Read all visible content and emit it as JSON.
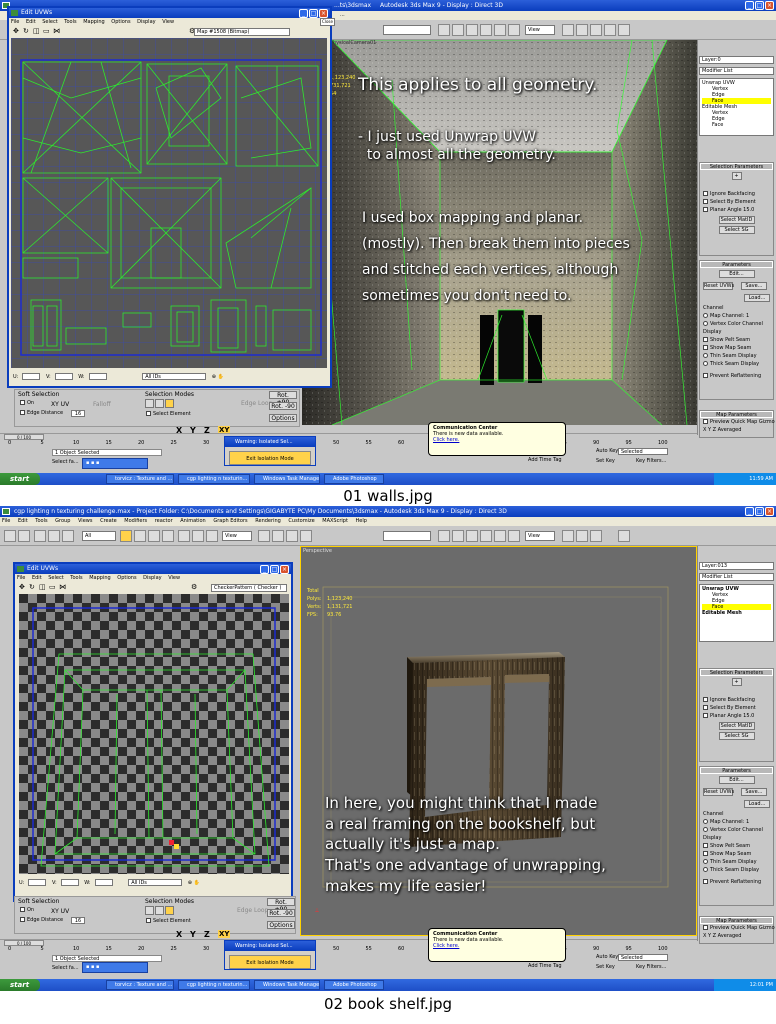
{
  "shot1": {
    "title": "Autodesk 3ds Max 9  -  Display : Direct 3D",
    "title_prefix": "...ts\\3dsmax",
    "menu": [
      "File",
      "Edit",
      "Tools",
      "Group",
      "Views",
      "Create",
      "Modifiers",
      "reactor",
      "Animation",
      "Graph Editors",
      "Rendering",
      "Customize",
      "MAXScript",
      "Help"
    ],
    "toolbar_select": "All",
    "toolbar_view": "View",
    "uvw": {
      "title": "Edit UVWs",
      "menu": [
        "File",
        "Edit",
        "Select",
        "Tools",
        "Mapping",
        "Options",
        "Display",
        "View"
      ],
      "map": "Map #1508 (Bitmap)",
      "close_label": "Close",
      "bottom_u": "U:",
      "bottom_v": "V:",
      "bottom_w": "W:",
      "ids": "All IDs",
      "soft_selection": "Soft Selection",
      "selection_modes": "Selection Modes",
      "on": "On",
      "xy_uv": "XY  UV",
      "falloff": "Falloff",
      "edge_distance": "Edge Distance",
      "edge_distance_val": "16",
      "select_element": "Select Element",
      "edge_loop": "Edge Loop",
      "rot_pos": "Rot. +90",
      "rot_neg": "Rot. -90",
      "options": "Options"
    },
    "viewport_label": "PhysicalCamera01",
    "stats": [
      "1,123,240",
      "731,721",
      "54"
    ],
    "overlay": {
      "line1": "This applies to all geometry.",
      "line2": "- I just used Unwrap UVW\n  to almost all the geometry.",
      "line3": "I used box mapping and planar.\n(mostly). Then break them into pieces\nand stitched each vertices, although\nsometimes you don't need to."
    },
    "panel": {
      "layer": "Layer:0",
      "modifier_list": "Modifier List",
      "stack": [
        "Unwrap UVW",
        "Vertex",
        "Edge",
        "Face",
        "Editable Mesh",
        "Vertex",
        "Edge",
        "Face"
      ],
      "selection_params": "Selection Parameters",
      "ignore_backfacing": "Ignore Backfacing",
      "select_by_element": "Select By Element",
      "planar_angle": "Planar Angle",
      "planar_angle_val": "15.0",
      "select_matid": "Select MatID",
      "select_sg": "Select SG",
      "parameters": "Parameters",
      "edit": "Edit...",
      "reset_uvws": "Reset UVWs",
      "save": "Save...",
      "load": "Load...",
      "channel": "Channel",
      "map_channel": "Map Channel:",
      "map_channel_val": "1",
      "vertex_color_channel": "Vertex Color Channel",
      "display": "Display",
      "show_pelt_seam": "Show Pelt Seam",
      "show_map_seam": "Show Map Seam",
      "thin_seam": "Thin Seam Display",
      "thick_seam": "Thick Seam Display",
      "prevent_reflattening": "Prevent Reflattening",
      "map_parameters": "Map Parameters",
      "preview_gizmo": "Preview Quick Map Gizmo",
      "xyz_axes": "X  Y  Z  Averaged"
    },
    "status": {
      "frame": "0 / 100",
      "objects": "1 Object Selected",
      "select_hint": "Select fa...",
      "warning": "Warning: Isolated Sel...",
      "exit_isolation": "Exit Isolation Mode",
      "auto_key": "Auto Key",
      "set_key": "Set Key",
      "selected": "Selected",
      "key_filters": "Key Filters...",
      "add_time_tag": "Add Time Tag"
    },
    "popup": {
      "title": "Communication Center",
      "body": "There is new data available.",
      "link": "Click here."
    },
    "timeline_ticks": [
      "0",
      "5",
      "10",
      "15",
      "20",
      "25",
      "30",
      "35",
      "40",
      "45",
      "50",
      "55",
      "60",
      "65",
      "70",
      "75",
      "80",
      "85",
      "90",
      "95",
      "100"
    ],
    "taskbar": {
      "start": "start",
      "tasks": [
        "torvicz : Texture and ...",
        "cgp lighting n texturin...",
        "Windows Task Manager",
        "Adobe Photoshop"
      ],
      "time": "11:59 AM"
    }
  },
  "caption1": "01 walls.jpg",
  "shot2": {
    "title": "cgp lighting n texturing challenge.max  -  Project Folder: C:\\Documents and Settings\\GIGABYTE PC\\My Documents\\3dsmax  -  Autodesk 3ds Max 9  -  Display : Direct 3D",
    "menu": [
      "File",
      "Edit",
      "Tools",
      "Group",
      "Views",
      "Create",
      "Modifiers",
      "reactor",
      "Animation",
      "Graph Editors",
      "Rendering",
      "Customize",
      "MAXScript",
      "Help"
    ],
    "toolbar_select": "All",
    "toolbar_view": "View",
    "uvw": {
      "title": "Edit UVWs",
      "menu": [
        "File",
        "Edit",
        "Select",
        "Tools",
        "Mapping",
        "Options",
        "Display",
        "View"
      ],
      "map": "CheckerPattern  ( Checker )",
      "ids": "All IDs",
      "soft_selection": "Soft Selection",
      "selection_modes": "Selection Modes",
      "on": "On",
      "xy_uv": "XY  UV",
      "edge_distance": "Edge Distance",
      "edge_distance_val": "16",
      "select_element": "Select Element",
      "edge_loop": "Edge Loop",
      "rot_pos": "Rot. +90",
      "rot_neg": "Rot. -90",
      "options": "Options"
    },
    "viewport_label": "Perspective",
    "stats_labels": [
      "Total",
      "Polys:",
      "Verts:",
      "FPS:"
    ],
    "stats": [
      "1,123,240",
      "1,131,721",
      "93.76"
    ],
    "overlay": "In here, you might think that I made\na real framing on the bookshelf, but\nactually it's just a map.\nThat's one advantage of unwrapping,\nmakes my life easier!",
    "panel": {
      "layer": "Layer:013",
      "modifier_list": "Modifier List",
      "stack": [
        "Unwrap UVW",
        "Vertex",
        "Edge",
        "Face",
        "Editable Mesh"
      ]
    },
    "status": {
      "frame": "0 / 100",
      "objects": "1 Object Selected",
      "select_hint": "Select fa...",
      "warning": "Warning: Isolated Sel...",
      "exit_isolation": "Exit Isolation Mode",
      "auto_key": "Auto Key",
      "set_key": "Set Key",
      "selected": "Selected",
      "key_filters": "Key Filters...",
      "add_time_tag": "Add Time Tag"
    },
    "popup": {
      "title": "Communication Center",
      "body": "There is new data available.",
      "link": "Click here."
    },
    "taskbar": {
      "start": "start",
      "tasks": [
        "torvicz : Texture and ...",
        "cgp lighting n texturin...",
        "Windows Task Manager",
        "Adobe Photoshop"
      ],
      "time": "12:01 PM"
    }
  },
  "caption2": "02 book shelf.jpg"
}
